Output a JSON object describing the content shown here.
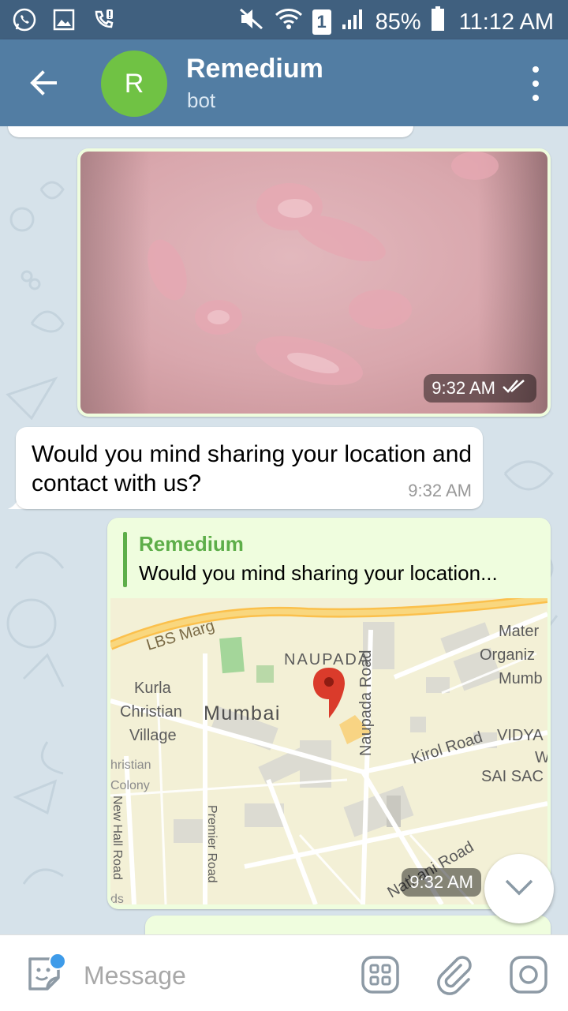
{
  "status_bar": {
    "battery": "85%",
    "time": "11:12 AM",
    "sim": "1",
    "left_icons": [
      "whatsapp-icon",
      "image-icon",
      "phone-alert-icon"
    ],
    "right_icons": [
      "mute-icon",
      "wifi-icon",
      "sim-icon",
      "signal-icon",
      "battery-icon"
    ]
  },
  "header": {
    "avatar_letter": "R",
    "title": "Remedium",
    "subtitle": "bot",
    "avatar_color": "#70c244",
    "bar_color": "#527da3"
  },
  "messages": {
    "photo": {
      "time": "9:32 AM",
      "status_icon": "double-check-icon"
    },
    "incoming": {
      "text": "Would you mind sharing your location and contact with us?",
      "time": "9:32 AM"
    },
    "location": {
      "reply_name": "Remedium",
      "reply_text": "Would you mind sharing your location...",
      "time": "9:32 AM",
      "map_labels": {
        "lbs": "LBS Marg",
        "naupada": "NAUPADA",
        "naupada_road": "Naupada Road",
        "mumbai": "Mumbai",
        "kurla": "Kurla",
        "christian": "Christian",
        "village": "Village",
        "hristian": "hristian",
        "colony": "Colony",
        "new_hall": "New Hall Road",
        "premier": "Premier Road",
        "kirol": "Kirol Road",
        "vidya": "VIDYA",
        "w": "W",
        "sai": "SAI SAC",
        "mater": "Mater",
        "organiz": "Organiz",
        "mumb": "Mumb",
        "nathani": "Nathani Road",
        "ds": "ds"
      }
    }
  },
  "composer": {
    "placeholder": "Message",
    "icons": [
      "sticker-icon",
      "bot-keyboard-icon",
      "attach-icon",
      "camera-icon"
    ]
  }
}
